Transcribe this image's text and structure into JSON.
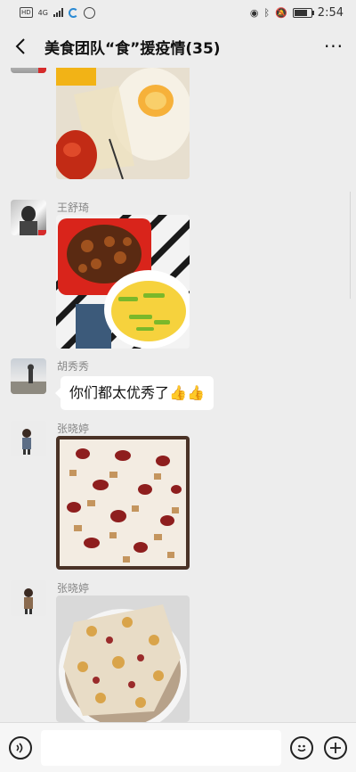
{
  "status_bar": {
    "hd": "HD",
    "network": "4G",
    "time": "2:54"
  },
  "header": {
    "title": "美食团队“食”援疫情(35)",
    "more": "···"
  },
  "messages": [
    {
      "sender": "王舒琦"
    },
    {
      "sender": "胡秀秀",
      "text": "你们都太优秀了",
      "emoji": "👍👍"
    },
    {
      "sender": "张晓婷"
    },
    {
      "sender": "张晓婷"
    }
  ],
  "icons": {
    "back": "back-arrow-icon",
    "more": "more-dots-icon",
    "voice": "voice-icon",
    "emoji": "emoji-icon",
    "plus": "plus-icon"
  },
  "colors": {
    "background": "#ededed",
    "bubble": "#ffffff",
    "name_text": "#888888"
  }
}
